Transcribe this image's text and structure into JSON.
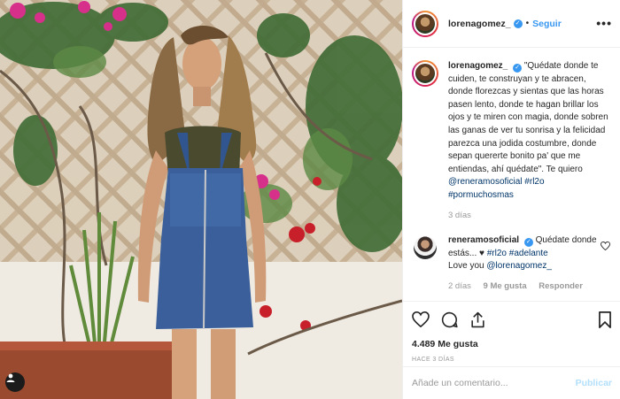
{
  "post": {
    "username": "lorenagomez_",
    "follow_label": "Seguir",
    "dot": "•",
    "more": "•••"
  },
  "caption": {
    "username": "lorenagomez_",
    "text": "\"Quédate donde te cuiden, te construyan y te abracen, donde florezcas y sientas que las horas pasen lento, donde te hagan brillar los ojos y te miren con magia, donde sobren las ganas de ver tu sonrisa y la felicidad parezca una jodida costumbre, donde sepan quererte bonito pa' que me entiendas, ahí quédate\". Te quiero",
    "mention": "@reneramosoficial",
    "hashtags": "#rl2o #pormuchosmas",
    "time": "3 días"
  },
  "reply": {
    "username": "reneramosoficial",
    "text_before": "Quédate donde estás...",
    "heart": "♥",
    "hashtag1": "#rl2o",
    "hashtag2": "#adelante",
    "line2": "Love you",
    "mention": "@lorenagomez_",
    "time": "2 días",
    "likes": "9 Me gusta",
    "reply_label": "Responder"
  },
  "likes_count": "4.489 Me gusta",
  "post_date": "HACE 3 DÍAS",
  "add_comment": {
    "placeholder": "Añade un comentario...",
    "publish_label": "Publicar"
  },
  "colors": {
    "accent": "#3897f0",
    "link": "#003569",
    "muted": "#999999",
    "publish_disabled": "#b2dffc"
  },
  "icons": [
    "verified-icon",
    "heart-icon",
    "comment-icon",
    "share-icon",
    "bookmark-icon",
    "user-tag-icon"
  ]
}
